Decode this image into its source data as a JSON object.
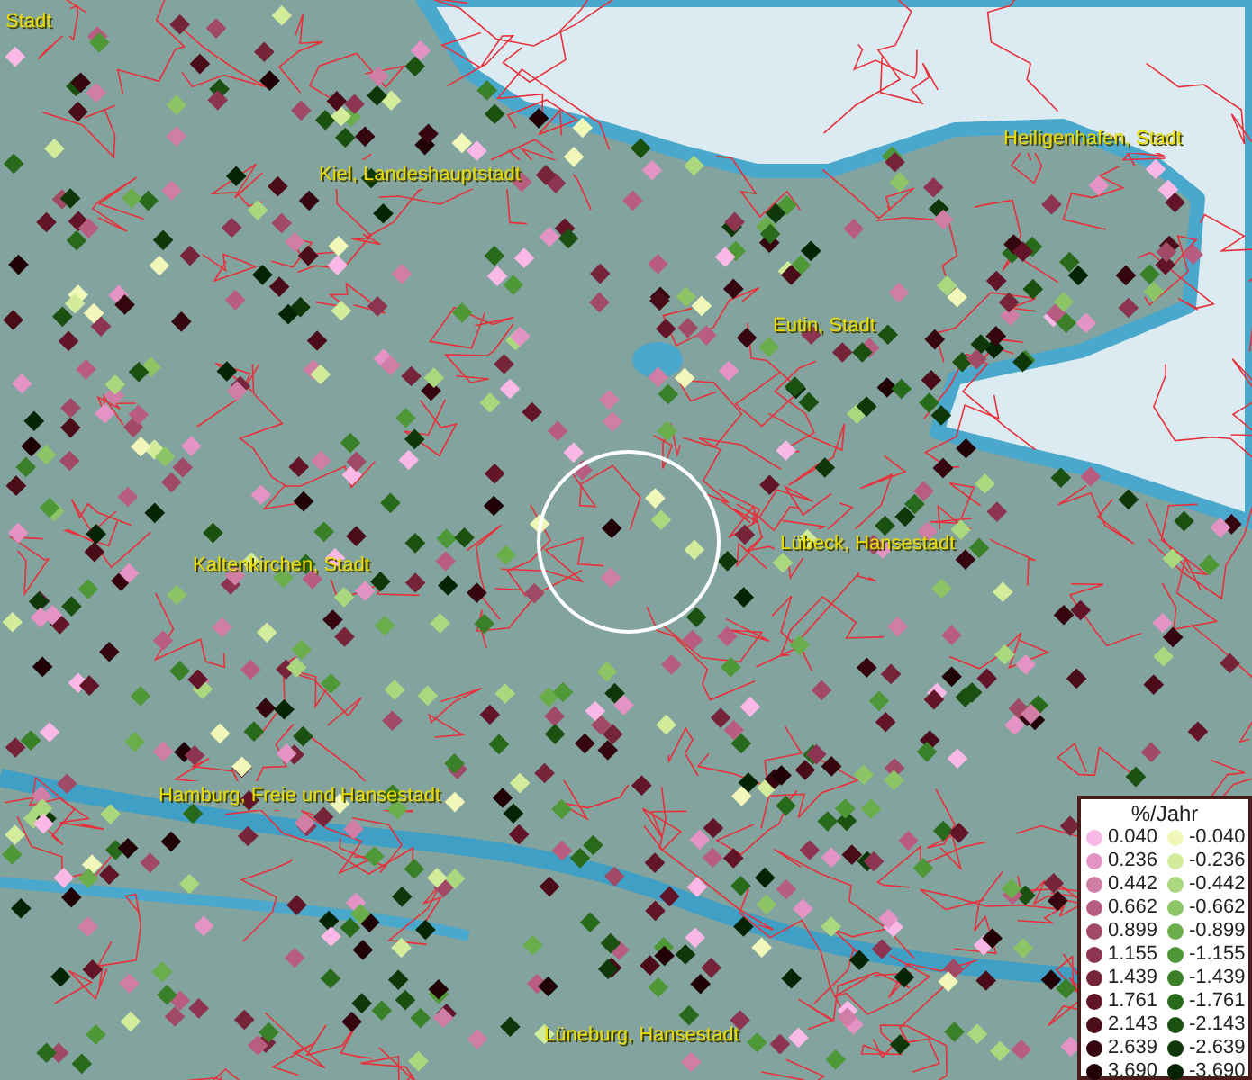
{
  "map": {
    "labels": [
      {
        "text": "Stadt"
      },
      {
        "text": "Kiel, Landeshauptstadt"
      },
      {
        "text": "Heiligenhafen, Stadt"
      },
      {
        "text": "Eutin, Stadt"
      },
      {
        "text": "Lübeck, Hansestadt"
      },
      {
        "text": "Kaltenkirchen, Stadt"
      },
      {
        "text": "Hamburg, Freie und Hansestadt"
      },
      {
        "text": "Lüneburg, Hansestadt"
      }
    ]
  },
  "legend": {
    "title": "%/Jahr",
    "positive": [
      {
        "label": "0.040",
        "color": "#f9b8e6"
      },
      {
        "label": "0.236",
        "color": "#e394c4"
      },
      {
        "label": "0.442",
        "color": "#d07ea5"
      },
      {
        "label": "0.662",
        "color": "#b85d80"
      },
      {
        "label": "0.899",
        "color": "#a04a66"
      },
      {
        "label": "1.155",
        "color": "#8c3450"
      },
      {
        "label": "1.439",
        "color": "#76243a"
      },
      {
        "label": "1.761",
        "color": "#621528"
      },
      {
        "label": "2.143",
        "color": "#4a0c18"
      },
      {
        "label": "2.639",
        "color": "#350610"
      },
      {
        "label": "3.690",
        "color": "#200206"
      }
    ],
    "negative": [
      {
        "label": "-0.040",
        "color": "#f0f7b8"
      },
      {
        "label": "-0.236",
        "color": "#d2ec9c"
      },
      {
        "label": "-0.442",
        "color": "#abd87e"
      },
      {
        "label": "-0.662",
        "color": "#8cc466"
      },
      {
        "label": "-0.899",
        "color": "#6aae4c"
      },
      {
        "label": "-1.155",
        "color": "#4e9838"
      },
      {
        "label": "-1.439",
        "color": "#3a8028"
      },
      {
        "label": "-1.761",
        "color": "#286a1c"
      },
      {
        "label": "-2.143",
        "color": "#1a5010"
      },
      {
        "label": "-2.639",
        "color": "#0e380a"
      },
      {
        "label": "-3.690",
        "color": "#042404"
      }
    ]
  }
}
